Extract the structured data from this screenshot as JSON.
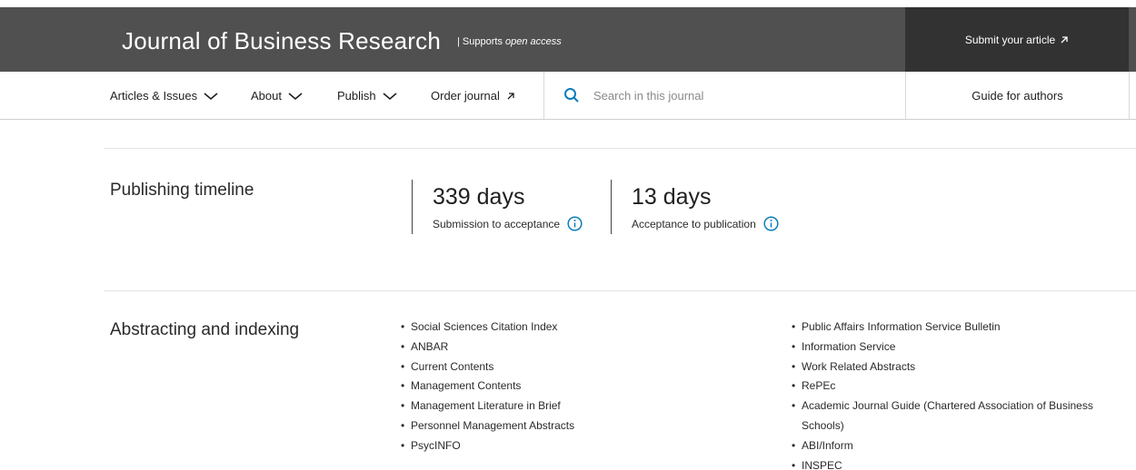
{
  "header": {
    "journal_title": "Journal of Business Research",
    "supports_prefix": "| Supports ",
    "supports_emphasis": "open access",
    "submit_label": "Submit your article",
    "submit_icon": "arrow-up-right-icon"
  },
  "nav": {
    "items": [
      {
        "label": "Articles & Issues",
        "icon": "chevron-down-icon"
      },
      {
        "label": "About",
        "icon": "chevron-down-icon"
      },
      {
        "label": "Publish",
        "icon": "chevron-down-icon"
      },
      {
        "label": "Order journal",
        "icon": "arrow-up-right-icon"
      }
    ],
    "search_placeholder": "Search in this journal",
    "guide_label": "Guide for authors"
  },
  "timeline": {
    "title": "Publishing timeline",
    "stats": [
      {
        "value": "339 days",
        "label": "Submission to acceptance"
      },
      {
        "value": "13 days",
        "label": "Acceptance to publication"
      }
    ]
  },
  "indexing": {
    "title": "Abstracting and indexing",
    "column1": [
      "Social Sciences Citation Index",
      "ANBAR",
      "Current Contents",
      "Management Contents",
      "Management Literature in Brief",
      "Personnel Management Abstracts",
      "PsycINFO"
    ],
    "column2": [
      "Public Affairs Information Service Bulletin",
      "Information Service",
      "Work Related Abstracts",
      "RePEc",
      "Academic Journal Guide (Chartered Association of Business Schools)",
      "ABI/Inform",
      "INSPEC"
    ]
  },
  "colors": {
    "header_bg": "#505050",
    "submit_bg": "#323232",
    "accent_blue": "#0c7dbb"
  }
}
